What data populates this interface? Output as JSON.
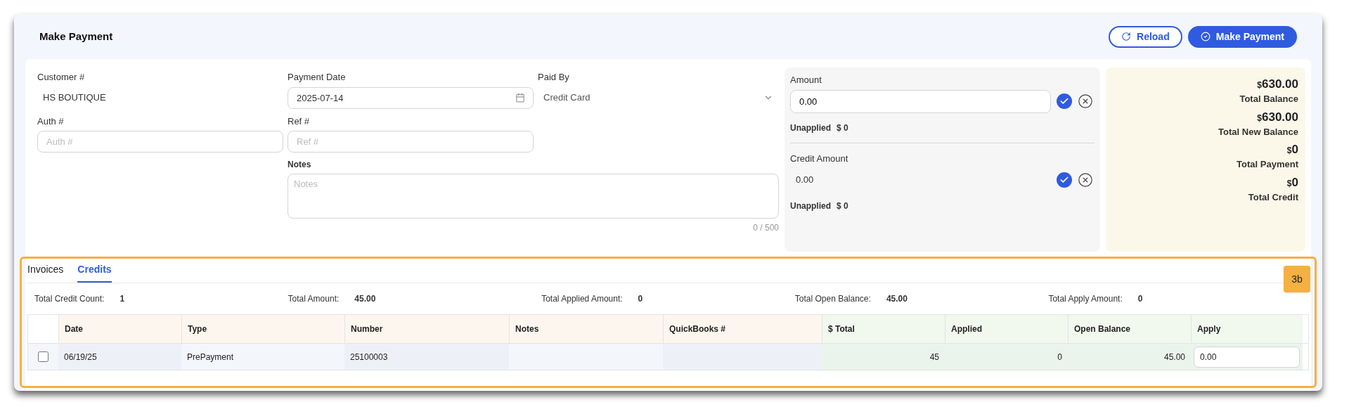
{
  "page": {
    "title": "Make Payment",
    "buttons": [
      {
        "kind": "outline",
        "label": "Reload"
      },
      {
        "kind": "primary",
        "label": "Make Payment"
      }
    ]
  },
  "form": {
    "customer": {
      "label": "Customer #",
      "value": "HS BOUTIQUE"
    },
    "payment_date": {
      "label": "Payment Date",
      "value": "2025-07-14"
    },
    "paid_by": {
      "label": "Paid By",
      "value": "Credit Card"
    },
    "auth": {
      "label": "Auth #",
      "placeholder": "Auth #"
    },
    "ref": {
      "label": "Ref #",
      "placeholder": "Ref #"
    },
    "notes": {
      "label": "Notes",
      "placeholder": "Notes",
      "counter": "0 / 500"
    }
  },
  "amount_panel": [
    {
      "label": "Amount",
      "value": "0.00",
      "kind": "input",
      "unapplied_label": "Unapplied",
      "unapplied_value": "$ 0"
    },
    {
      "label": "Credit Amount",
      "value": "0.00",
      "kind": "text",
      "unapplied_label": "Unapplied",
      "unapplied_value": "$ 0"
    }
  ],
  "totals": [
    {
      "currency": "$",
      "value": "630.00",
      "label": "Total Balance"
    },
    {
      "currency": "$",
      "value": "630.00",
      "label": "Total New Balance"
    },
    {
      "currency": "$",
      "value": "0",
      "label": "Total Payment"
    },
    {
      "currency": "$",
      "value": "0",
      "label": "Total Credit"
    }
  ],
  "annotation": {
    "label": "3b"
  },
  "tabs": [
    {
      "label": "Invoices",
      "selected": false
    },
    {
      "label": "Credits",
      "selected": true
    }
  ],
  "summary": [
    {
      "label": "Total Credit Count:",
      "value": "1"
    },
    {
      "label": "Total Amount:",
      "value": "45.00"
    },
    {
      "label": "Total Applied Amount:",
      "value": "0"
    },
    {
      "label": "Total Open Balance:",
      "value": "45.00"
    },
    {
      "label": "Total Apply Amount:",
      "value": "0"
    }
  ],
  "table": {
    "columns": [
      {
        "label": "Date",
        "kind": "info"
      },
      {
        "label": "Type",
        "kind": "info"
      },
      {
        "label": "Number",
        "kind": "info"
      },
      {
        "label": "Notes",
        "kind": "info"
      },
      {
        "label": "QuickBooks #",
        "kind": "info"
      },
      {
        "label": "$ Total",
        "kind": "money"
      },
      {
        "label": "Applied",
        "kind": "money"
      },
      {
        "label": "Open Balance",
        "kind": "money"
      },
      {
        "label": "Apply",
        "kind": "money"
      }
    ],
    "rows": [
      {
        "checked": false,
        "cells": [
          "06/19/25",
          "PrePayment",
          "25100003",
          "",
          "",
          "45",
          "0",
          "45.00"
        ],
        "apply": "0.00"
      }
    ]
  }
}
